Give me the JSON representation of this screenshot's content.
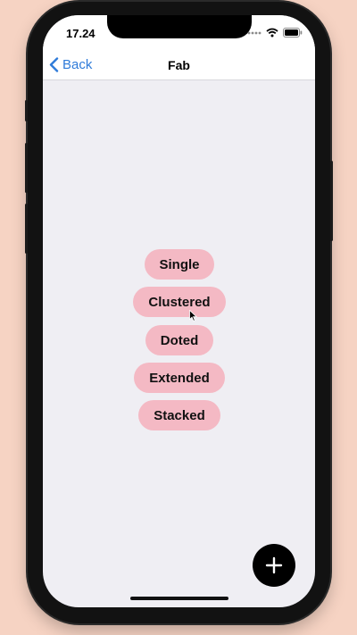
{
  "status_bar": {
    "time": "17.24",
    "icons": [
      "cellular-dots-icon",
      "wifi-icon",
      "battery-icon"
    ]
  },
  "navbar": {
    "back_label": "Back",
    "title": "Fab"
  },
  "buttons": [
    {
      "label": "Single"
    },
    {
      "label": "Clustered"
    },
    {
      "label": "Doted"
    },
    {
      "label": "Extended"
    },
    {
      "label": "Stacked"
    }
  ],
  "fab": {
    "icon": "plus-icon"
  },
  "colors": {
    "accent": "#2f7bd9",
    "pill_bg": "#f4b9c4",
    "fab_bg": "#000000",
    "screen_bg": "#efeef3"
  }
}
